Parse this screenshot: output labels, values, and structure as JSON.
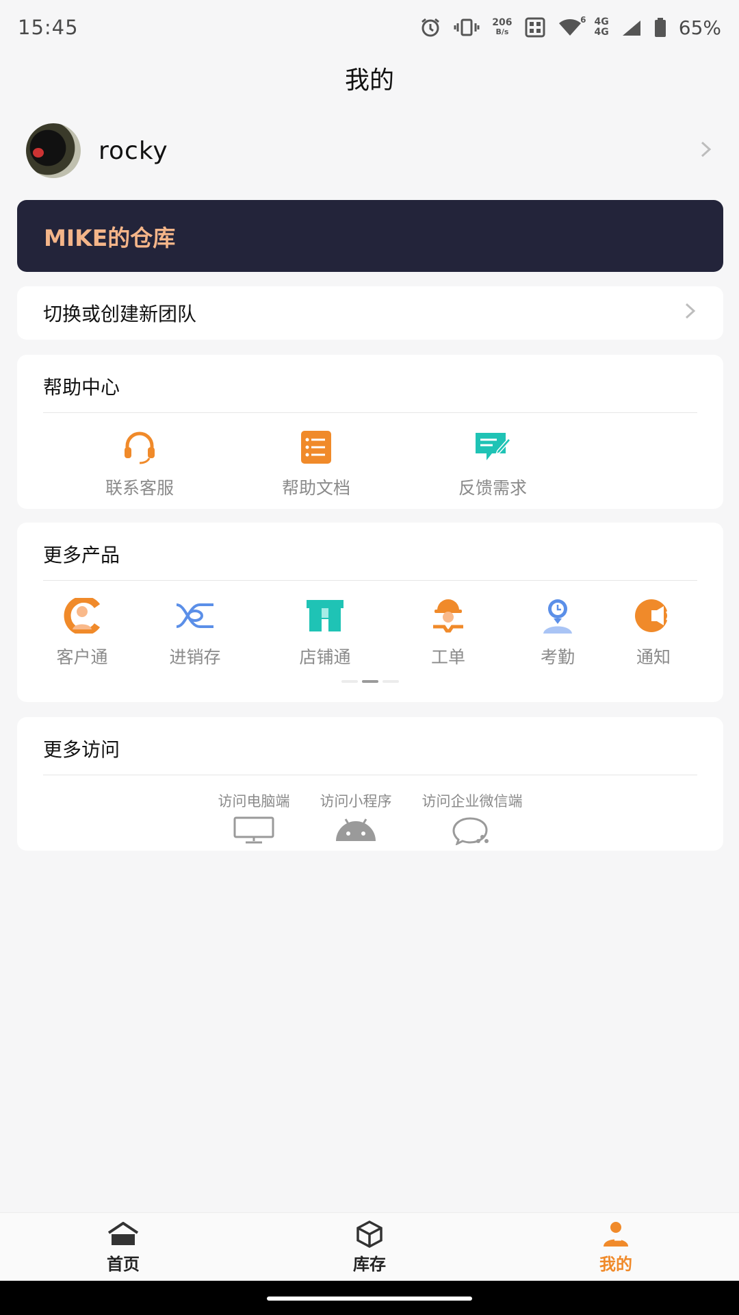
{
  "status_bar": {
    "time": "15:45",
    "net_speed_value": "206",
    "net_speed_unit": "B/s",
    "network_top": "4G",
    "network_bottom": "4G",
    "wifi_badge": "6",
    "battery": "65%"
  },
  "page_title": "我的",
  "profile": {
    "username": "rocky"
  },
  "team": {
    "name": "MIKE的仓库"
  },
  "switch_team": {
    "label": "切换或创建新团队"
  },
  "help_center": {
    "title": "帮助中心",
    "items": [
      {
        "label": "联系客服",
        "icon": "headset-icon"
      },
      {
        "label": "帮助文档",
        "icon": "document-list-icon"
      },
      {
        "label": "反馈需求",
        "icon": "feedback-icon"
      }
    ]
  },
  "more_products": {
    "title": "更多产品",
    "items": [
      {
        "label": "客户通",
        "icon": "customer-icon"
      },
      {
        "label": "进销存",
        "icon": "inventory-icon"
      },
      {
        "label": "店铺通",
        "icon": "store-icon"
      },
      {
        "label": "工单",
        "icon": "worker-icon"
      },
      {
        "label": "考勤",
        "icon": "attendance-icon"
      },
      {
        "label": "通知",
        "icon": "notification-icon"
      }
    ],
    "page_count": 3,
    "active_page": 1
  },
  "more_access": {
    "title": "更多访问",
    "items": [
      {
        "label": "访问电脑端",
        "icon": "monitor-icon"
      },
      {
        "label": "访问小程序",
        "icon": "android-icon"
      },
      {
        "label": "访问企业微信端",
        "icon": "wechat-work-icon"
      }
    ]
  },
  "bottom_nav": {
    "items": [
      {
        "label": "首页",
        "icon": "home-icon"
      },
      {
        "label": "库存",
        "icon": "box-icon"
      },
      {
        "label": "我的",
        "icon": "user-icon",
        "active": true
      }
    ]
  },
  "colors": {
    "accent": "#f08a2a",
    "banner_bg": "#23243a",
    "banner_text": "#f4b589",
    "teal": "#1fc3b5",
    "blue": "#5b8fe8"
  }
}
